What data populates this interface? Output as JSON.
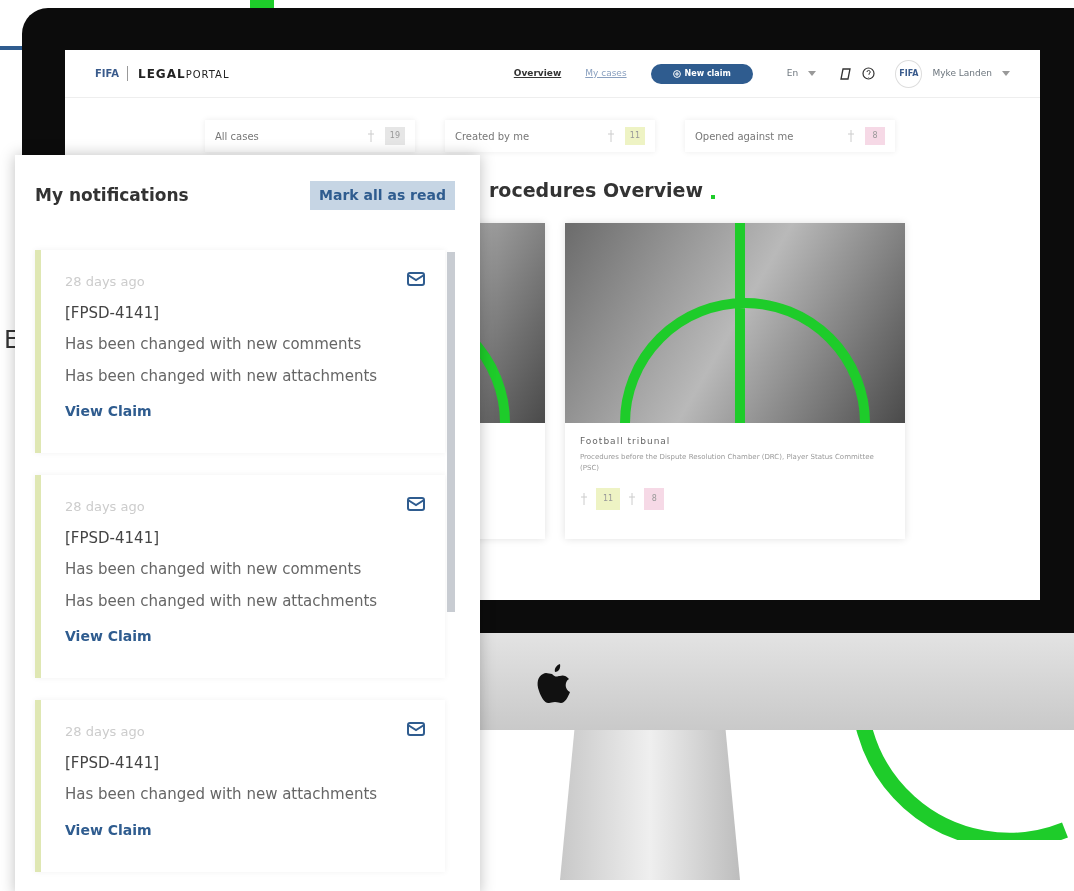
{
  "header": {
    "logo_mark": "FIFA",
    "logo_text": "LEGAL",
    "logo_text_2": "PORTAL",
    "nav": [
      {
        "label": "Overview",
        "selected": true
      },
      {
        "label": "My cases",
        "selected": false
      }
    ],
    "new_claim": "New claim",
    "language": "En",
    "user_badge": "FIFA",
    "user_name": "Myke Landen"
  },
  "filters": [
    {
      "label": "All cases",
      "count": "19",
      "color": "#e6e6e6"
    },
    {
      "label": "Created by me",
      "count": "11",
      "color": "#eef3c4"
    },
    {
      "label": "Opened against me",
      "count": "8",
      "color": "#f6d9e6"
    }
  ],
  "section_title": "rocedures Overview",
  "cards": [
    {
      "kind": "hidden"
    },
    {
      "kind": "full",
      "title": "Football tribunal",
      "description": "Procedures before the Dispute Resolution Chamber (DRC), Player Status Committee (PSC)",
      "counts": [
        {
          "value": "11",
          "color": "#eef3c4"
        },
        {
          "value": "8",
          "color": "#f6d9e6"
        }
      ]
    }
  ],
  "backdrop_fragment": "E",
  "notifications": {
    "title": "My notifications",
    "mark_all": "Mark all as read",
    "items": [
      {
        "time": "28 days ago",
        "key": "[FPSD-4141]",
        "lines": [
          "Has been changed with new comments",
          "Has been changed with new attachments"
        ],
        "link": "View Claim",
        "unread": true
      },
      {
        "time": "28 days ago",
        "key": "[FPSD-4141]",
        "lines": [
          "Has been changed with new comments",
          "Has been changed with new attachments"
        ],
        "link": "View Claim",
        "unread": true
      },
      {
        "time": "28 days ago",
        "key": "[FPSD-4141]",
        "lines": [
          "Has been changed with new attachments"
        ],
        "link": "View Claim",
        "unread": true
      }
    ]
  }
}
